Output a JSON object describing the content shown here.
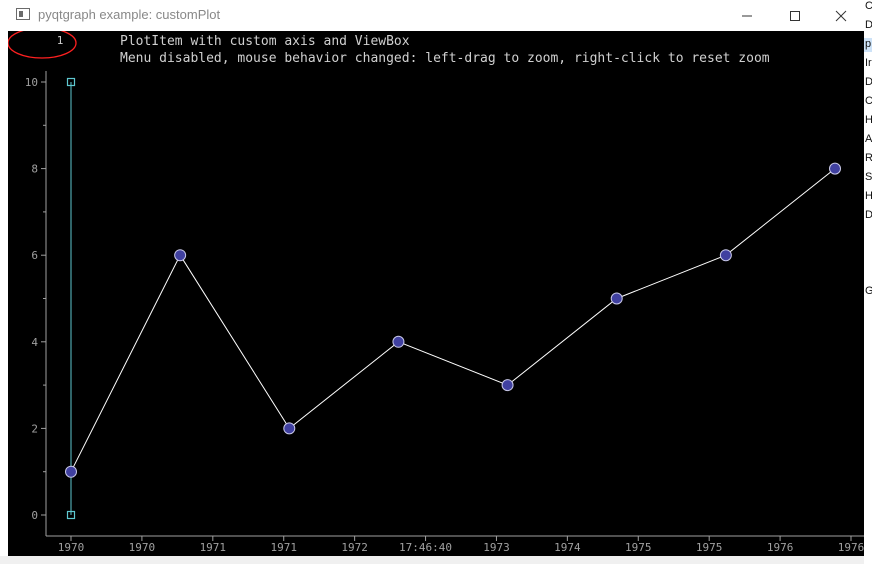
{
  "window": {
    "title": "pyqtgraph example: customPlot",
    "icon": "window-app-icon",
    "controls": [
      "minimize-icon",
      "maximize-icon",
      "close-icon"
    ]
  },
  "plot": {
    "range_label": "1",
    "title_line1": "PlotItem with custom axis and ViewBox",
    "title_line2": "Menu disabled, mouse behavior changed: left-drag to zoom, right-click to reset zoom",
    "annotation": "red-circle-around-range-label",
    "colors": {
      "background": "#000000",
      "axis": "#a0a0a0",
      "line": "#ffffff",
      "marker_fill": "#4040a0",
      "roi": "#5ec8d0",
      "annotation": "#ff2020"
    }
  },
  "right_strip": {
    "letters": [
      "C",
      "D",
      "p",
      "Ir",
      "D",
      "C",
      "H",
      "A",
      "R",
      "S",
      "H",
      "D",
      "G"
    ]
  },
  "chart_data": {
    "type": "line",
    "title": "PlotItem with custom axis and ViewBox",
    "subtitle": "Menu disabled, mouse behavior changed: left-drag to zoom, right-click to reset zoom",
    "x_tick_labels": [
      "1970",
      "1970",
      "1971",
      "1971",
      "1972",
      "17:46:40",
      "1973",
      "1974",
      "1975",
      "1975",
      "1976",
      "1976"
    ],
    "y_ticks": [
      0,
      2,
      4,
      6,
      8,
      10
    ],
    "ylim": [
      -0.4,
      10.5
    ],
    "xlim": [
      -0.05,
      7.35
    ],
    "series": [
      {
        "x": [
          0,
          1,
          2,
          3,
          4,
          5,
          6,
          7
        ],
        "values": [
          1,
          6,
          2,
          4,
          3,
          5,
          6,
          8
        ]
      }
    ],
    "roi_line": {
      "x": 0,
      "y_from": 0,
      "y_to": 10
    },
    "grid": false,
    "legend": "none"
  }
}
